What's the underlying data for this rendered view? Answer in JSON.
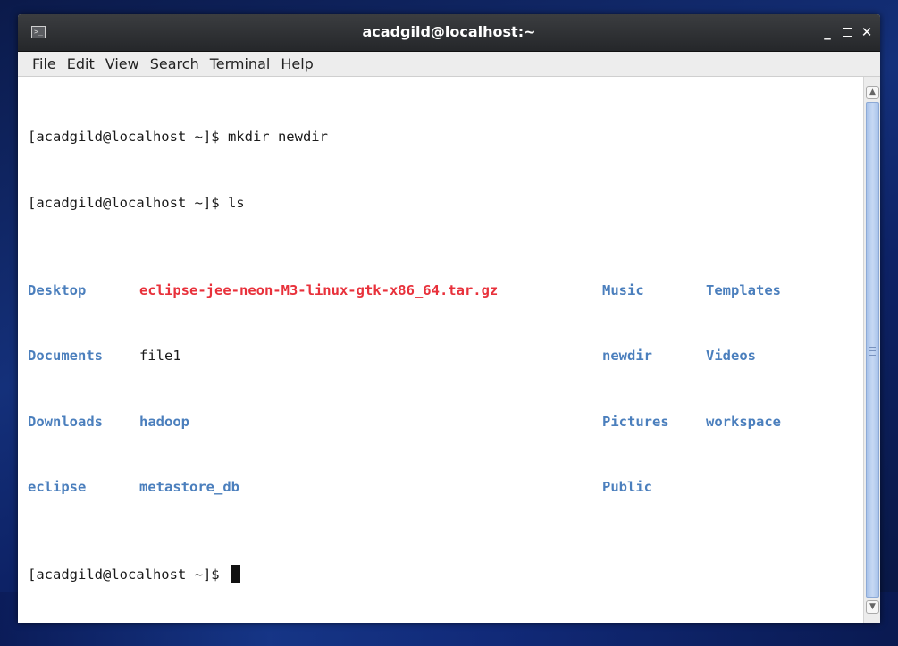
{
  "window": {
    "title": "acadgild@localhost:~",
    "icon": "terminal-icon",
    "controls": {
      "minimize": "_",
      "maximize": "",
      "close": "✕"
    }
  },
  "menubar": {
    "items": [
      "File",
      "Edit",
      "View",
      "Search",
      "Terminal",
      "Help"
    ]
  },
  "terminal": {
    "lines": [
      "[acadgild@localhost ~]$ mkdir newdir",
      "[acadgild@localhost ~]$ ls"
    ],
    "ls_rows": [
      [
        {
          "name": "Desktop",
          "kind": "dir"
        },
        {
          "name": "eclipse-jee-neon-M3-linux-gtk-x86_64.tar.gz",
          "kind": "archive"
        },
        {
          "name": "Music",
          "kind": "dir"
        },
        {
          "name": "Templates",
          "kind": "dir"
        }
      ],
      [
        {
          "name": "Documents",
          "kind": "dir"
        },
        {
          "name": "file1",
          "kind": "file"
        },
        {
          "name": "newdir",
          "kind": "dir"
        },
        {
          "name": "Videos",
          "kind": "dir"
        }
      ],
      [
        {
          "name": "Downloads",
          "kind": "dir"
        },
        {
          "name": "hadoop",
          "kind": "dir"
        },
        {
          "name": "Pictures",
          "kind": "dir"
        },
        {
          "name": "workspace",
          "kind": "dir"
        }
      ],
      [
        {
          "name": "eclipse",
          "kind": "dir"
        },
        {
          "name": "metastore_db",
          "kind": "dir"
        },
        {
          "name": "Public",
          "kind": "dir"
        },
        {
          "name": "",
          "kind": "empty"
        }
      ]
    ],
    "prompt": "[acadgild@localhost ~]$ "
  },
  "colors": {
    "directory": "#4b7fbd",
    "archive": "#e8313b",
    "text": "#1a1a1a",
    "titlebar": "#2e3033"
  }
}
